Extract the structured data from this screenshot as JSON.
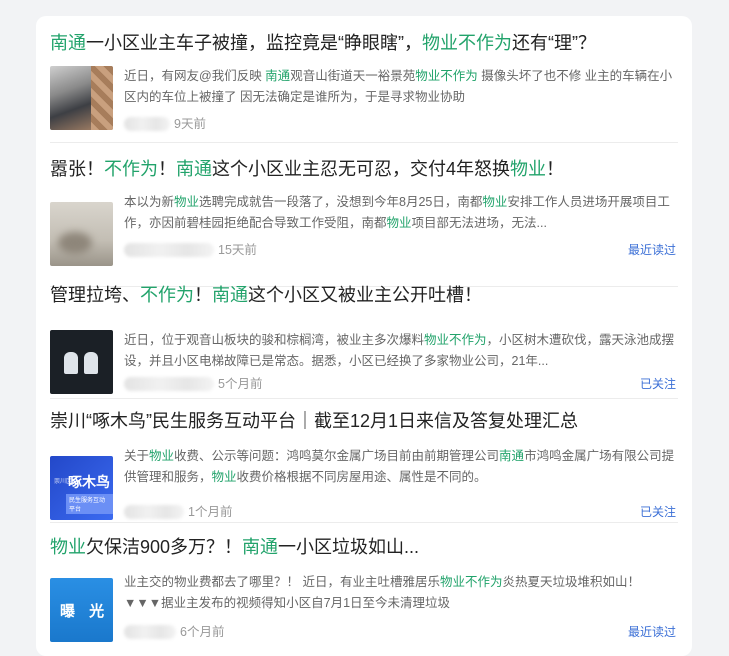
{
  "colors": {
    "highlight": "#22a36b",
    "tag": "#3b6fd6",
    "meta": "#999999"
  },
  "articles": [
    {
      "title": [
        {
          "text": "南通",
          "hl": true
        },
        {
          "text": "一小区业主车子被撞，监控竟是“睁眼瞎”，",
          "hl": false
        },
        {
          "text": "物业不作为",
          "hl": true
        },
        {
          "text": "还有“理”？",
          "hl": false
        }
      ],
      "desc": [
        {
          "text": "近日，有网友@我们反映 ",
          "hl": false
        },
        {
          "text": "南通",
          "hl": true
        },
        {
          "text": "观音山街道天一裕景苑",
          "hl": false
        },
        {
          "text": "物业不作为",
          "hl": true
        },
        {
          "text": " 摄像头坏了也不修 业主的车辆在小区内的车位上被撞了 因无法确定是谁所为，于是寻求物业协助",
          "hl": false
        }
      ],
      "time": "9天前",
      "tag": "",
      "thumb": "car-photo"
    },
    {
      "title": [
        {
          "text": "嚣张！",
          "hl": false
        },
        {
          "text": "不作为",
          "hl": true
        },
        {
          "text": "！",
          "hl": false
        },
        {
          "text": "南通",
          "hl": true
        },
        {
          "text": "这个小区业主忍无可忍，交付4年怒换",
          "hl": false
        },
        {
          "text": "物业",
          "hl": true
        },
        {
          "text": "！",
          "hl": false
        }
      ],
      "desc": [
        {
          "text": "本以为新",
          "hl": false
        },
        {
          "text": "物业",
          "hl": true
        },
        {
          "text": "选聘完成就告一段落了，没想到今年8月25日，南都",
          "hl": false
        },
        {
          "text": "物业",
          "hl": true
        },
        {
          "text": "安排工作人员进场开展项目工作，亦因前碧桂园拒绝配合导致工作受阻，南都",
          "hl": false
        },
        {
          "text": "物业",
          "hl": true
        },
        {
          "text": "项目部无法进场，无法...",
          "hl": false
        }
      ],
      "time": "15天前",
      "tag": "最近读过",
      "thumb": "wall-photo"
    },
    {
      "title": [
        {
          "text": "管理拉垮、",
          "hl": false
        },
        {
          "text": "不作为",
          "hl": true
        },
        {
          "text": "！",
          "hl": false
        },
        {
          "text": "南通",
          "hl": true
        },
        {
          "text": "这个小区又被业主公开吐槽！",
          "hl": false
        }
      ],
      "desc": [
        {
          "text": "近日，位于观音山板块的骏和棕榈湾，被业主多次爆料",
          "hl": false
        },
        {
          "text": "物业不作为",
          "hl": true
        },
        {
          "text": "，小区树木遭砍伐，露天泳池成摆设，并且小区电梯故障已是常态。据悉，小区已经换了多家物业公司，21年...",
          "hl": false
        }
      ],
      "time": "5个月前",
      "tag": "已关注",
      "thumb": "dark-logo"
    },
    {
      "title": [
        {
          "text": "崇川“啄木鸟”民生服务互动平台｜截至12月1日来信及答复处理汇总",
          "hl": false
        }
      ],
      "desc": [
        {
          "text": "关于",
          "hl": false
        },
        {
          "text": "物业",
          "hl": true
        },
        {
          "text": "收费、公示等问题：鸿鸣莫尔金属广场目前由前期管理公司",
          "hl": false
        },
        {
          "text": "南通",
          "hl": true
        },
        {
          "text": "市鸿鸣金属广场有限公司提供管理和服务，",
          "hl": false
        },
        {
          "text": "物业",
          "hl": true
        },
        {
          "text": "收费价格根据不同房屋用途、属性是不同的。",
          "hl": false
        }
      ],
      "time": "1个月前",
      "tag": "已关注",
      "thumb": "platform-logo",
      "thumb_text": {
        "small": "崇川区",
        "large": "啄木鸟",
        "strip": "民生服务互动平台"
      }
    },
    {
      "title": [
        {
          "text": "物业",
          "hl": true
        },
        {
          "text": "欠保洁900多万？！",
          "hl": false
        },
        {
          "text": "南通",
          "hl": true
        },
        {
          "text": "一小区垃圾如山...",
          "hl": false
        }
      ],
      "desc": [
        {
          "text": "业主交的物业费都去了哪里？！ 近日，有业主吐槽雅居乐",
          "hl": false
        },
        {
          "text": "物业不作为",
          "hl": true
        },
        {
          "text": "炎热夏天垃圾堆积如山！ ▼▼▼据业主发布的视频得知小区自7月1日至今未清理垃圾",
          "hl": false
        }
      ],
      "time": "6个月前",
      "tag": "最近读过",
      "thumb": "exposure-logo",
      "thumb_text": {
        "large": "曝 光"
      }
    }
  ]
}
